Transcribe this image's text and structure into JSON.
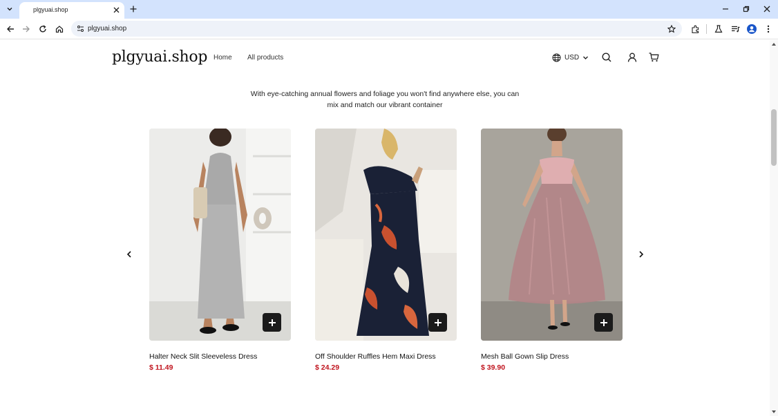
{
  "browser": {
    "tab_title": "plgyuai.shop",
    "url": "plgyuai.shop"
  },
  "header": {
    "logo": "plgyuai.shop",
    "nav": [
      "Home",
      "All products"
    ],
    "currency": "USD"
  },
  "intro_text": "With eye-catching annual flowers and foliage you won't find anywhere else, you can mix and match our vibrant container",
  "products": [
    {
      "name": "Halter Neck Slit Sleeveless Dress",
      "price": "$ 11.49"
    },
    {
      "name": "Off Shoulder Ruffles Hem Maxi Dress",
      "price": "$ 24.29"
    },
    {
      "name": "Mesh Ball Gown Slip Dress",
      "price": "$ 39.90"
    }
  ],
  "colors": {
    "price": "#c0141e",
    "tabbar": "#d3e3fd",
    "add_button": "#1b1b1b"
  },
  "icons": {
    "tab_dropdown": "chevron-down-icon",
    "tab_close": "close-icon",
    "new_tab": "plus-icon",
    "back": "arrow-left-icon",
    "forward": "arrow-right-icon",
    "reload": "reload-icon",
    "home": "home-icon",
    "site_info": "site-settings-icon",
    "bookmark": "star-icon",
    "extensions": "puzzle-icon",
    "labs": "flask-icon",
    "media": "media-queue-icon",
    "profile": "profile-icon",
    "menu": "more-vertical-icon",
    "currency": "globe-icon",
    "search": "search-icon",
    "account": "user-icon",
    "cart": "cart-icon",
    "carousel_prev": "chevron-left-icon",
    "carousel_next": "chevron-right-icon"
  }
}
